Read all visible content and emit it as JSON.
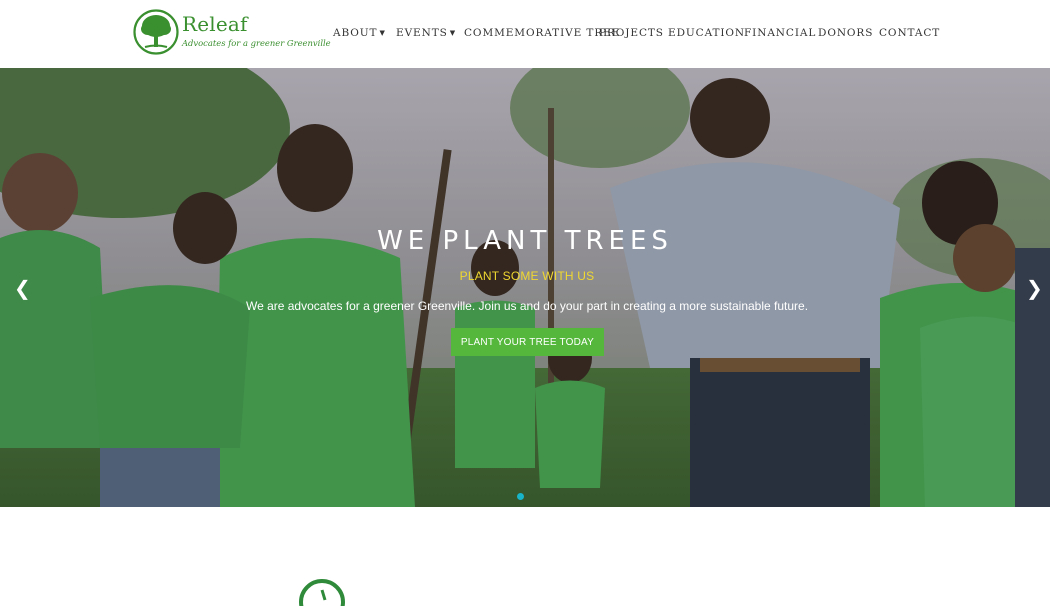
{
  "header": {
    "logo": {
      "name": "Releaf",
      "tagline": "Advocates for a greener Greenville"
    },
    "nav": [
      {
        "label": "ABOUT",
        "has_dropdown": true
      },
      {
        "label": "EVENTS",
        "has_dropdown": true
      },
      {
        "label": "COMMEMORATIVE TREE",
        "has_dropdown": false
      },
      {
        "label": "PROJECTS",
        "has_dropdown": false
      },
      {
        "label": "EDUCATION",
        "has_dropdown": false
      },
      {
        "label": "FINANCIAL",
        "has_dropdown": false
      },
      {
        "label": "DONORS",
        "has_dropdown": false
      },
      {
        "label": "CONTACT",
        "has_dropdown": false
      }
    ]
  },
  "hero": {
    "title": "WE PLANT TREES",
    "subtitle": "PLANT SOME WITH US",
    "description": "We are advocates for a greener Greenville. Join us and do your part in creating a more sustainable future.",
    "cta_label": "PLANT YOUR TREE TODAY",
    "prev_icon": "chevron-left-icon",
    "next_icon": "chevron-right-icon",
    "slide_count": 1,
    "active_slide": 1
  },
  "colors": {
    "brand_green": "#3a8f2f",
    "cta_green": "#55b83c",
    "subtitle_yellow": "#f0d830",
    "indicator_teal": "#18b4c8"
  }
}
